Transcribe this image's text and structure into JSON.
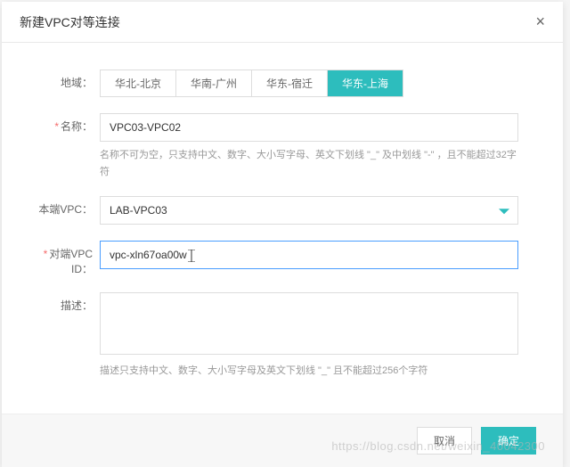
{
  "modal": {
    "title": "新建VPC对等连接"
  },
  "form": {
    "region": {
      "label": "地域：",
      "options": [
        "华北-北京",
        "华南-广州",
        "华东-宿迁",
        "华东-上海"
      ],
      "selected_index": 3
    },
    "name": {
      "label": "名称：",
      "value": "VPC03-VPC02",
      "help": "名称不可为空，只支持中文、数字、大小写字母、英文下划线 \"_\" 及中划线 \"-\" ，且不能超过32字符"
    },
    "local_vpc": {
      "label": "本端VPC：",
      "value": "LAB-VPC03"
    },
    "peer_vpc_id": {
      "label": "对端VPC ID：",
      "value": "vpc-xln67oa00w"
    },
    "description": {
      "label": "描述：",
      "value": "",
      "help": "描述只支持中文、数字、大小写字母及英文下划线 \"_\" 且不能超过256个字符"
    }
  },
  "footer": {
    "cancel": "取消",
    "confirm": "确定"
  },
  "watermark": "https://blog.csdn.net/weixin_40042300"
}
